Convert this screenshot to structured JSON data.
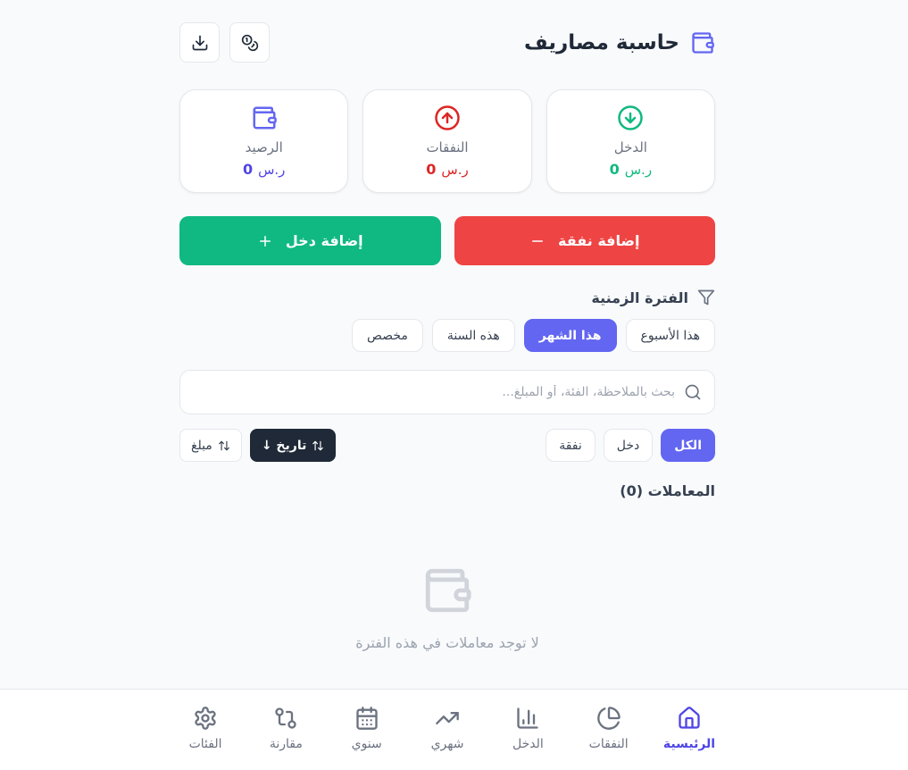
{
  "header": {
    "title": "حاسبة مصاريف",
    "title_icon": "wallet-icon",
    "actions": [
      {
        "name": "currency-button",
        "icon": "coins-icon"
      },
      {
        "name": "download-button",
        "icon": "download-icon"
      }
    ]
  },
  "summary": {
    "income": {
      "label": "الدخل",
      "value": "0",
      "currency": "ر.س",
      "icon": "arrow-down-circle-icon",
      "color": "#10b981"
    },
    "expenses": {
      "label": "النفقات",
      "value": "0",
      "currency": "ر.س",
      "icon": "arrow-up-circle-icon",
      "color": "#dc2626"
    },
    "balance": {
      "label": "الرصيد",
      "value": "0",
      "currency": "ر.س",
      "icon": "wallet-icon",
      "color": "#4f46e5"
    }
  },
  "actions": {
    "add_expense": "إضافة نفقة",
    "add_income": "إضافة دخل"
  },
  "period": {
    "title": "الفترة الزمنية",
    "tabs": [
      "هذا الأسبوع",
      "هذا الشهر",
      "هذه السنة",
      "مخصص"
    ],
    "active": "هذا الشهر"
  },
  "search": {
    "placeholder": "بحث بالملاحظة، الفئة، أو المبلغ...",
    "value": ""
  },
  "type_filter": {
    "tabs": [
      "الكل",
      "دخل",
      "نفقة"
    ],
    "active": "الكل"
  },
  "sort": {
    "date": "تاريخ ↓",
    "amount": "مبلغ",
    "active": "date"
  },
  "transactions": {
    "title": "المعاملات (0)",
    "empty_text": "لا توجد معاملات في هذه الفترة"
  },
  "nav": {
    "items": [
      {
        "label": "الرئيسية",
        "icon": "home-icon",
        "active": true
      },
      {
        "label": "النفقات",
        "icon": "pie-chart-icon"
      },
      {
        "label": "الدخل",
        "icon": "bar-chart-icon"
      },
      {
        "label": "شهري",
        "icon": "trending-up-icon"
      },
      {
        "label": "سنوي",
        "icon": "calendar-icon"
      },
      {
        "label": "مقارنة",
        "icon": "compare-icon"
      },
      {
        "label": "الفئات",
        "icon": "settings-icon"
      }
    ],
    "active_color": "#4f46e5"
  },
  "colors": {
    "primary": "#6366f1",
    "expense": "#ef4444",
    "income": "#10b981",
    "dark": "#1f2937",
    "background": "#f8fafc"
  }
}
